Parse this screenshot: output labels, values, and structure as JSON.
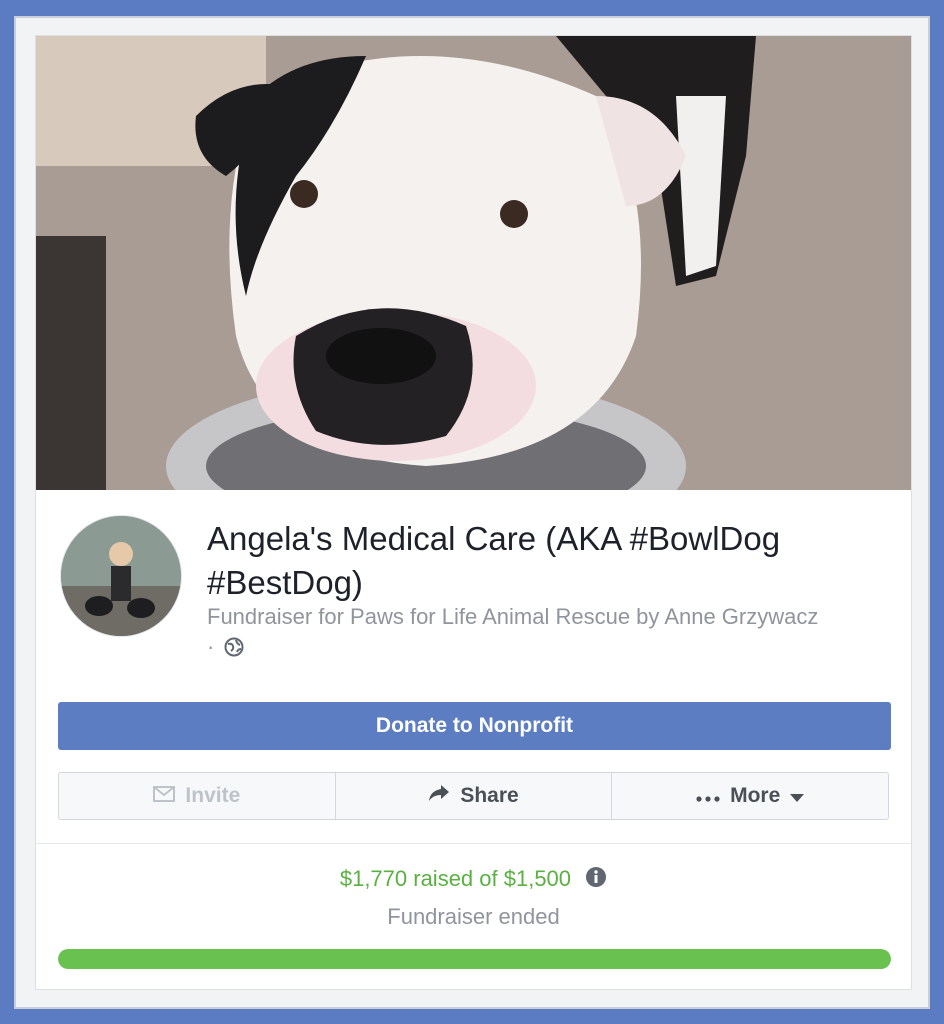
{
  "fundraiser": {
    "title": "Angela's Medical Care (AKA #BowlDog #BestDog)",
    "subtitle": "Fundraiser for Paws for Life Animal Rescue by Anne Grzywacz ·",
    "cover_alt": "Dog holding a steel bowl in its mouth",
    "avatar_alt": "Woman with two dogs"
  },
  "buttons": {
    "donate_label": "Donate to Nonprofit",
    "invite_label": "Invite",
    "share_label": "Share",
    "more_label": "More"
  },
  "icons": {
    "invite": "envelope-icon",
    "share": "share-arrow-icon",
    "more": "ellipsis-icon",
    "more_caret": "caret-down-icon",
    "privacy": "globe-icon",
    "info": "info-icon"
  },
  "progress": {
    "raised_text": "$1,770 raised of $1,500",
    "status": "Fundraiser ended",
    "fraction": 1.0
  },
  "colors": {
    "page_border": "#5b7cc3",
    "donate_button": "#5d7dc2",
    "raised_text": "#5ab142",
    "progress_fill": "#69c150"
  }
}
